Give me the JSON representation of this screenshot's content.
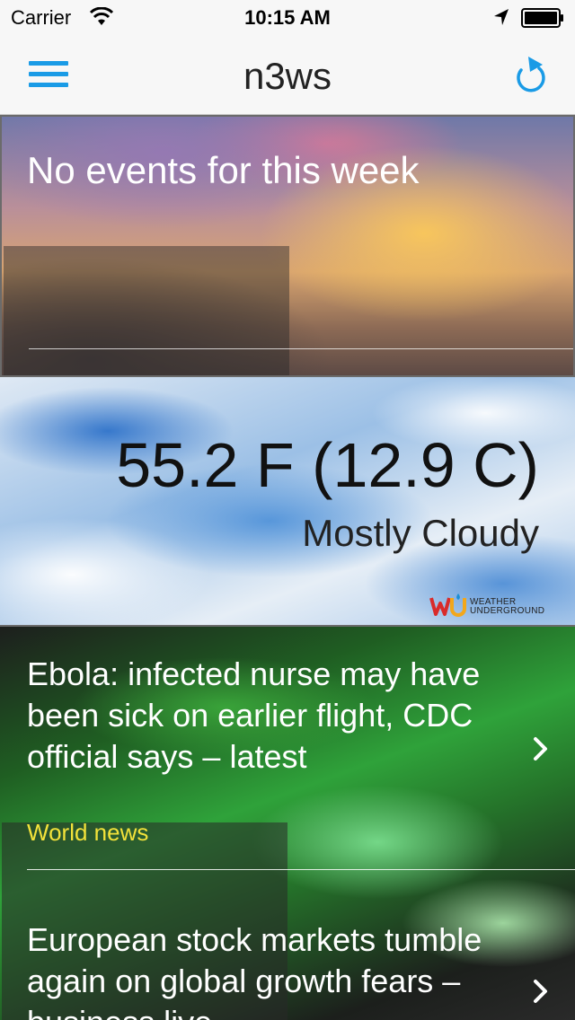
{
  "status_bar": {
    "carrier": "Carrier",
    "time": "10:15 AM"
  },
  "nav": {
    "title": "n3ws",
    "menu_icon": "hamburger-icon",
    "refresh_icon": "refresh-icon",
    "accent_color": "#1a9be6"
  },
  "events": {
    "headline": "No events for this week"
  },
  "weather": {
    "temperature": "55.2 F (12.9 C)",
    "condition": "Mostly Cloudy",
    "provider": {
      "logo_text": "WU",
      "name_line1": "WEATHER",
      "name_line2": "UNDERGROUND"
    }
  },
  "news": {
    "items": [
      {
        "title": "Ebola: infected nurse may have been sick on earlier flight, CDC official says – latest",
        "category": "World news",
        "chevron_icon": "chevron-right-icon"
      },
      {
        "title": "European stock markets tumble again on global growth fears – business live",
        "chevron_icon": "chevron-right-icon"
      }
    ],
    "category_color": "#f2e23a"
  }
}
